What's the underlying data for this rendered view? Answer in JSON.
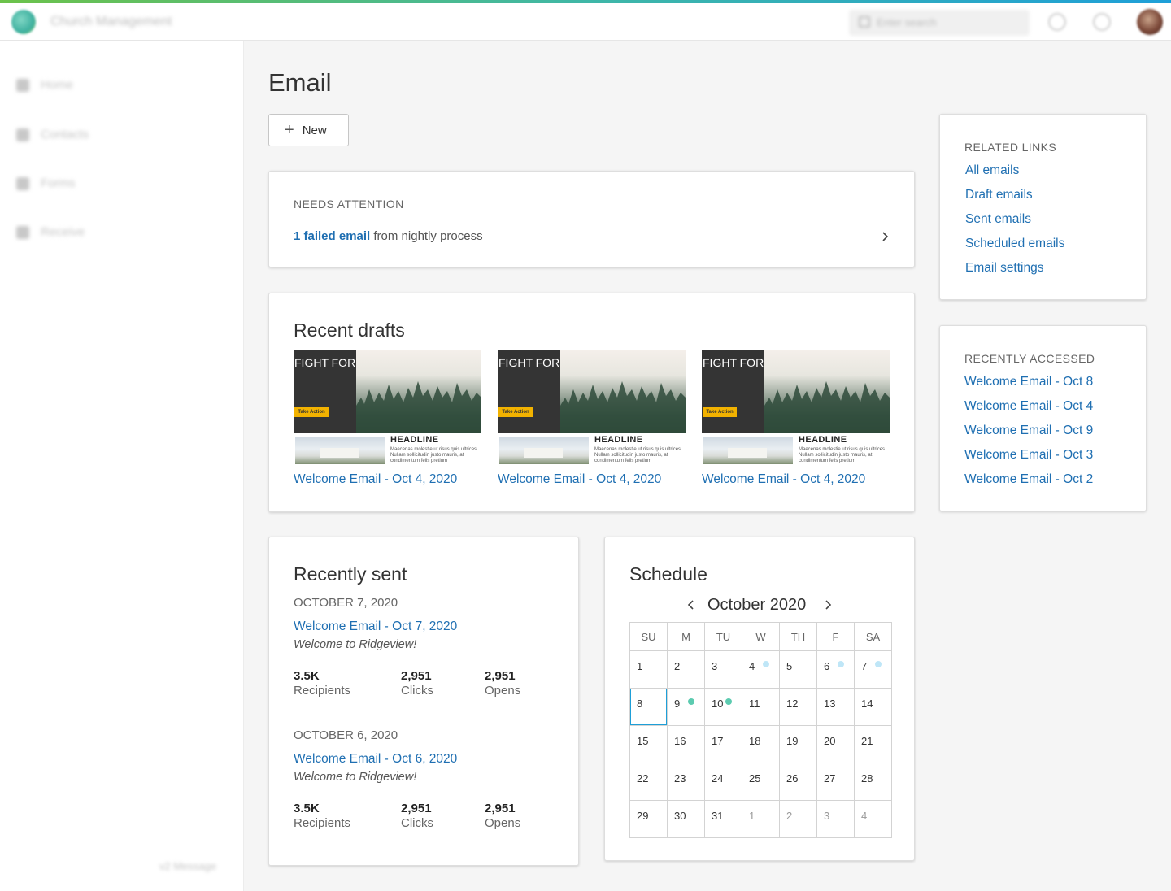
{
  "app": {
    "title": "Church Management",
    "search_placeholder": "Enter search",
    "icons": {
      "logo": "app-logo",
      "help": "help-icon",
      "notifications": "bell-icon",
      "avatar": "user-avatar"
    }
  },
  "sidebar": {
    "items": [
      {
        "label": "Home",
        "icon": "home-icon"
      },
      {
        "label": "Contacts",
        "icon": "person-icon"
      },
      {
        "label": "Forms",
        "icon": "form-icon"
      },
      {
        "label": "Receive",
        "icon": "card-icon"
      }
    ],
    "footer": "v2 Message"
  },
  "page": {
    "title": "Email",
    "new_button": "New"
  },
  "needs_attention": {
    "heading": "NEEDS ATTENTION",
    "link_text": "1 failed email",
    "suffix": " from nightly process"
  },
  "recent_drafts": {
    "heading": "Recent drafts",
    "thumbnail": {
      "fight_text": "FIGHT FOR WHAT MATTERS",
      "button": "Take Action",
      "headline": "HEADLINE",
      "body": "Maecenas molestie ut risus quis ultrices. Nullam sollicitudin justo mauris, at condimentum felis pretium"
    },
    "items": [
      {
        "label": "Welcome Email - Oct 4, 2020"
      },
      {
        "label": "Welcome Email - Oct 4, 2020"
      },
      {
        "label": "Welcome Email - Oct 4, 2020"
      }
    ]
  },
  "recently_sent": {
    "heading": "Recently sent",
    "groups": [
      {
        "date": "OCTOBER 7, 2020",
        "link": "Welcome Email - Oct 7, 2020",
        "subject": "Welcome to Ridgeview!",
        "stats": [
          {
            "value": "3.5K",
            "label": "Recipients"
          },
          {
            "value": "2,951",
            "label": "Clicks"
          },
          {
            "value": "2,951",
            "label": "Opens"
          }
        ]
      },
      {
        "date": "OCTOBER 6, 2020",
        "link": "Welcome Email - Oct 6, 2020",
        "subject": "Welcome to Ridgeview!",
        "stats": [
          {
            "value": "3.5K",
            "label": "Recipients"
          },
          {
            "value": "2,951",
            "label": "Clicks"
          },
          {
            "value": "2,951",
            "label": "Opens"
          }
        ]
      }
    ]
  },
  "schedule": {
    "heading": "Schedule",
    "month": "October 2020",
    "weekdays": [
      "SU",
      "M",
      "TU",
      "W",
      "TH",
      "F",
      "SA"
    ],
    "colors": {
      "scheduled": "#bfe6f7",
      "sent": "#5ccbb0",
      "today_border": "#1e9fd8"
    },
    "weeks": [
      [
        {
          "d": "1"
        },
        {
          "d": "2"
        },
        {
          "d": "3"
        },
        {
          "d": "4",
          "dot": "scheduled"
        },
        {
          "d": "5"
        },
        {
          "d": "6",
          "dot": "scheduled"
        },
        {
          "d": "7",
          "dot": "scheduled"
        }
      ],
      [
        {
          "d": "8",
          "today": true
        },
        {
          "d": "9",
          "dot": "sent"
        },
        {
          "d": "10",
          "dot": "sent"
        },
        {
          "d": "11"
        },
        {
          "d": "12"
        },
        {
          "d": "13"
        },
        {
          "d": "14"
        }
      ],
      [
        {
          "d": "15"
        },
        {
          "d": "16"
        },
        {
          "d": "17"
        },
        {
          "d": "18"
        },
        {
          "d": "19"
        },
        {
          "d": "20"
        },
        {
          "d": "21"
        }
      ],
      [
        {
          "d": "22"
        },
        {
          "d": "23"
        },
        {
          "d": "24"
        },
        {
          "d": "25"
        },
        {
          "d": "26"
        },
        {
          "d": "27"
        },
        {
          "d": "28"
        }
      ],
      [
        {
          "d": "29"
        },
        {
          "d": "30"
        },
        {
          "d": "31"
        },
        {
          "d": "1",
          "other": true
        },
        {
          "d": "2",
          "other": true
        },
        {
          "d": "3",
          "other": true
        },
        {
          "d": "4",
          "other": true
        }
      ]
    ]
  },
  "related_links": {
    "heading": "RELATED LINKS",
    "items": [
      "All emails",
      "Draft emails",
      "Sent emails",
      "Scheduled emails",
      "Email settings"
    ]
  },
  "recently_accessed": {
    "heading": "RECENTLY ACCESSED",
    "items": [
      "Welcome Email - Oct 8",
      "Welcome Email - Oct 4",
      "Welcome Email - Oct 9",
      "Welcome Email - Oct 3",
      "Welcome Email - Oct 2"
    ]
  }
}
